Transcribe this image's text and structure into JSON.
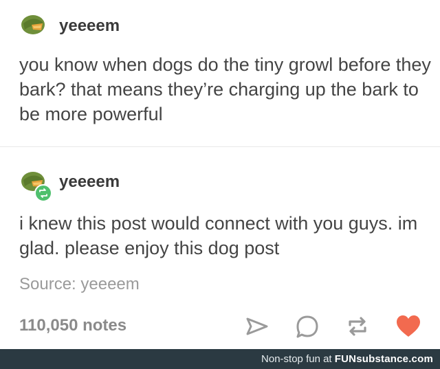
{
  "original_post": {
    "username": "yeeeem",
    "text": "you know when dogs do the tiny growl before they bark? that means they’re charging up the bark to be more powerful"
  },
  "reblog": {
    "username": "yeeeem",
    "text": "i knew this post would connect with you guys. im glad. please enjoy this dog post",
    "reblog_icon": "reblog-icon"
  },
  "source": {
    "label": "Source: yeeeem"
  },
  "footer_actions": {
    "notes": "110,050 notes",
    "share_icon": "share-icon",
    "reply_icon": "reply-icon",
    "reblog_icon": "reblog-icon",
    "like_icon": "heart-icon"
  },
  "watermark": {
    "prefix": "Non-stop fun at ",
    "brand": "FUNsubstance.com"
  },
  "colors": {
    "like": "#f26a4f",
    "reblog_badge": "#4fc06d",
    "footer_bg": "#2b3a42"
  }
}
